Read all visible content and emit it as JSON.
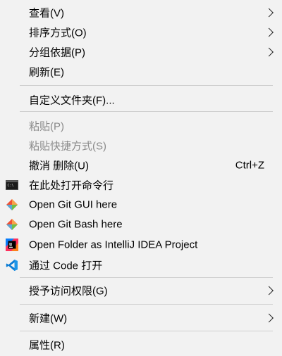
{
  "menu": {
    "view": "查看(V)",
    "sort": "排序方式(O)",
    "group": "分组依据(P)",
    "refresh": "刷新(E)",
    "customize": "自定义文件夹(F)...",
    "paste": "粘贴(P)",
    "paste_shortcut": "粘贴快捷方式(S)",
    "undo": "撤消 删除(U)",
    "undo_shortcut": "Ctrl+Z",
    "open_cmd": "在此处打开命令行",
    "git_gui": "Open Git GUI here",
    "git_bash": "Open Git Bash here",
    "intellij": "Open Folder as IntelliJ IDEA Project",
    "vscode": "通过 Code 打开",
    "grant_access": "授予访问权限(G)",
    "new": "新建(W)",
    "properties": "属性(R)"
  },
  "icons": {
    "cmd": "command-prompt-icon",
    "git_gui": "git-icon",
    "git_bash": "git-icon",
    "intellij": "intellij-idea-icon",
    "vscode": "vscode-icon"
  },
  "colors": {
    "background": "#f2f2f2",
    "disabled_text": "#8a8a8a",
    "separator": "#cfcfcf",
    "git": "#f05133",
    "vscode": "#0078d4"
  }
}
